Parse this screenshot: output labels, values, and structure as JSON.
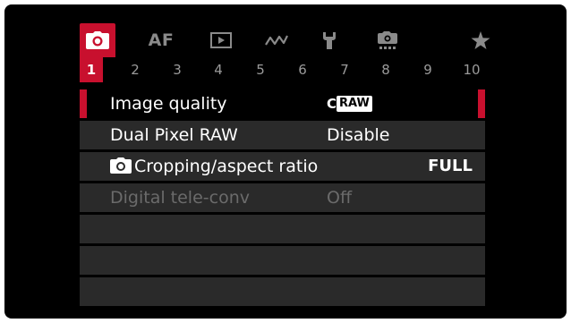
{
  "tabs": [
    {
      "name": "shooting",
      "icon": "camera-icon",
      "label": "",
      "active": true
    },
    {
      "name": "af",
      "icon": "",
      "label": "AF",
      "active": false
    },
    {
      "name": "playback",
      "icon": "playback-icon",
      "label": "",
      "active": false
    },
    {
      "name": "wireless",
      "icon": "wireless-icon",
      "label": "",
      "active": false
    },
    {
      "name": "setup",
      "icon": "wrench-icon",
      "label": "",
      "active": false
    },
    {
      "name": "custom-functions",
      "icon": "custom-camera-icon",
      "label": "",
      "active": false
    },
    {
      "name": "my-menu",
      "icon": "star-icon",
      "label": "",
      "active": false
    }
  ],
  "pages": [
    "1",
    "2",
    "3",
    "4",
    "5",
    "6",
    "7",
    "8",
    "9",
    "10"
  ],
  "active_page": "1",
  "menu": {
    "items": [
      {
        "label": "Image quality",
        "value_prefix": "C",
        "value_badge": "RAW",
        "selected": true,
        "disabled": false
      },
      {
        "label": "Dual Pixel RAW",
        "value": "Disable",
        "selected": false,
        "disabled": false
      },
      {
        "label": "Cropping/aspect ratio",
        "value": "FULL",
        "icon": "camera-icon",
        "selected": false,
        "disabled": false
      },
      {
        "label": "Digital tele-conv",
        "value": "Off",
        "selected": false,
        "disabled": true
      }
    ]
  },
  "colors": {
    "accent": "#c8102e",
    "row_bg": "#2a2a2a",
    "background": "#000000",
    "text": "#ffffff",
    "disabled_text": "#6b6b6b",
    "inactive_icon": "#8a8a8a"
  }
}
